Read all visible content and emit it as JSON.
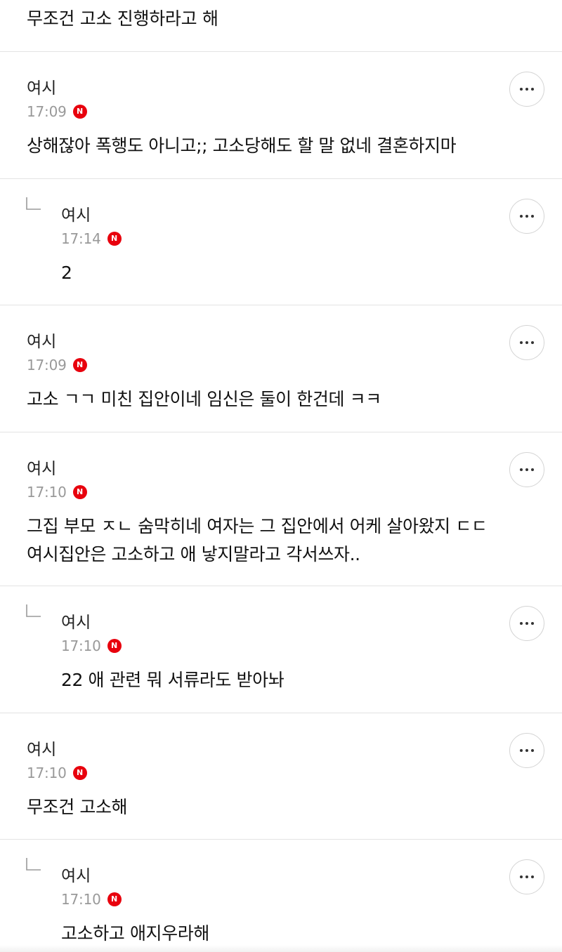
{
  "top_comment": {
    "content": "무조건 고소 진행하라고 해"
  },
  "comments": [
    {
      "author": "여시",
      "time": "17:09",
      "badge": "N",
      "content": "상해잖아 폭행도 아니고;; 고소당해도 할 말 없네 결혼하지마",
      "reply": false
    },
    {
      "author": "여시",
      "time": "17:14",
      "badge": "N",
      "content": "2",
      "reply": true
    },
    {
      "author": "여시",
      "time": "17:09",
      "badge": "N",
      "content": "고소 ㄱㄱ 미친 집안이네 임신은 둘이 한건데 ㅋㅋ",
      "reply": false
    },
    {
      "author": "여시",
      "time": "17:10",
      "badge": "N",
      "content": "그집 부모 ㅈㄴ 숨막히네 여자는 그 집안에서 어케 살아왔지 ㄷㄷ\n여시집안은 고소하고 애 낳지말라고 각서쓰자..",
      "reply": false
    },
    {
      "author": "여시",
      "time": "17:10",
      "badge": "N",
      "content": "22 애 관련 뭐 서류라도 받아놔",
      "reply": true
    },
    {
      "author": "여시",
      "time": "17:10",
      "badge": "N",
      "content": "무조건 고소해",
      "reply": false
    },
    {
      "author": "여시",
      "time": "17:10",
      "badge": "N",
      "content": "고소하고 애지우라해",
      "reply": true
    }
  ],
  "icons": {
    "more": "more-horizontal-icon",
    "reply": "reply-arrow-icon"
  },
  "colors": {
    "badge": "#e8000d",
    "divider": "#e3e3e3",
    "time": "#999999"
  }
}
